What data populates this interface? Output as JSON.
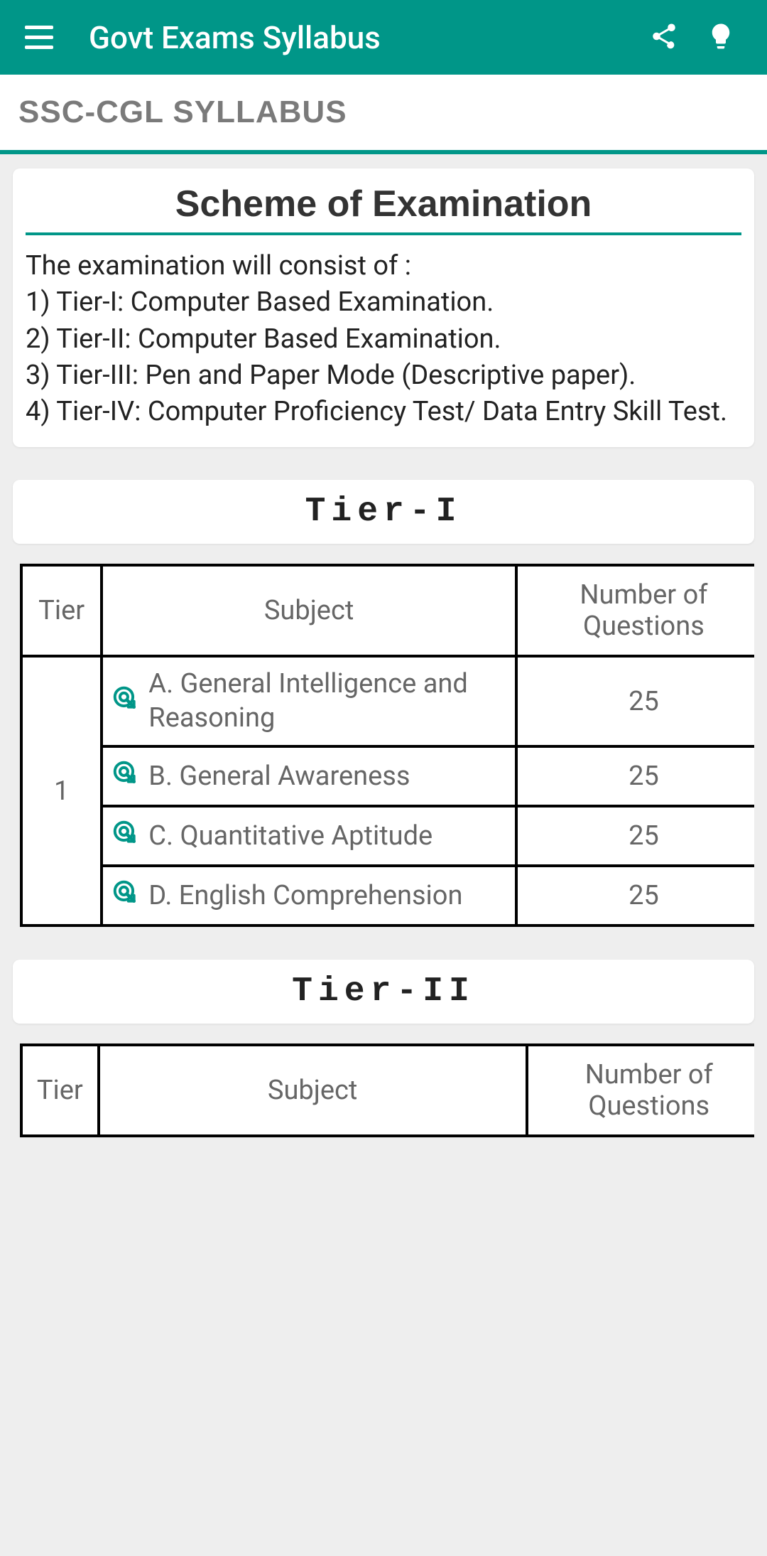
{
  "appbar": {
    "title": "Govt Exams Syllabus"
  },
  "subtitle": "SSC-CGL SYLLABUS",
  "scheme": {
    "heading": "Scheme of Examination",
    "intro": "The examination will consist of :",
    "lines": [
      "1) Tier-I: Computer Based Examination.",
      "2) Tier-II: Computer Based Examination.",
      "3) Tier-III: Pen and Paper Mode (Descriptive paper).",
      "4) Tier-IV: Computer Proficiency Test/ Data Entry Skill Test."
    ]
  },
  "tier1": {
    "label": "Tier-I",
    "headers": {
      "tier": "Tier",
      "subject": "Subject",
      "num": "Number of Questions"
    },
    "tier_value": "1",
    "rows": [
      {
        "subject": "A. General Intelligence and Reasoning",
        "num": "25"
      },
      {
        "subject": "B. General Awareness",
        "num": "25"
      },
      {
        "subject": "C. Quantitative Aptitude",
        "num": "25"
      },
      {
        "subject": "D. English Comprehension",
        "num": "25"
      }
    ]
  },
  "tier2": {
    "label": "Tier-II",
    "headers": {
      "tier": "Tier",
      "subject": "Subject",
      "num": "Number of Questions"
    }
  }
}
